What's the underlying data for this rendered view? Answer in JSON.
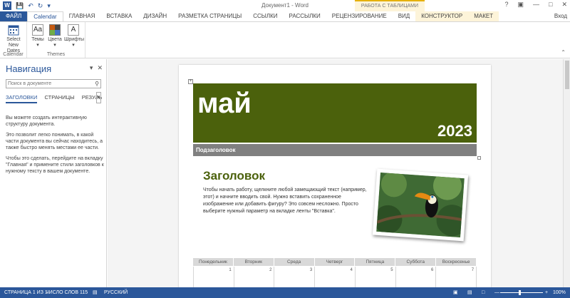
{
  "titlebar": {
    "title": "Документ1 - Word",
    "context_banner": "РАБОТА С ТАБЛИЦАМИ",
    "signin": "Вход",
    "word_icon": "W",
    "qat": {
      "save_icon": "save-icon",
      "undo_icon": "undo-icon",
      "redo_icon": "redo-icon",
      "customize_icon": "customize-qat-icon"
    },
    "window_controls": {
      "help": "?",
      "ribbon_options": "▣",
      "minimize": "—",
      "maximize": "□",
      "close": "✕"
    }
  },
  "tabs": [
    {
      "label": "ФАЙЛ"
    },
    {
      "label": "Calendar"
    },
    {
      "label": "ГЛАВНАЯ"
    },
    {
      "label": "ВСТАВКА"
    },
    {
      "label": "ДИЗАЙН"
    },
    {
      "label": "РАЗМЕТКА СТРАНИЦЫ"
    },
    {
      "label": "ССЫЛКИ"
    },
    {
      "label": "РАССЫЛКИ"
    },
    {
      "label": "РЕЦЕНЗИРОВАНИЕ"
    },
    {
      "label": "ВИД"
    },
    {
      "label": "КОНСТРУКТОР"
    },
    {
      "label": "МАКЕТ"
    }
  ],
  "ribbon": {
    "calendar_group": {
      "label": "Calendar",
      "select_dates_line1": "Select",
      "select_dates_line2": "New Dates"
    },
    "themes_group": {
      "label": "Themes",
      "themes_btn": "Темы",
      "colors_btn": "Цвета",
      "fonts_btn": "Шрифты",
      "fonts_glyph": "A",
      "themes_glyph": "Aa",
      "dropdown": "▾"
    }
  },
  "navpane": {
    "title": "Навигация",
    "search_placeholder": "Поиск в документе",
    "tabs": [
      "ЗАГОЛОВКИ",
      "СТРАНИЦЫ",
      "РЕЗУЛЬ"
    ],
    "more": "▸",
    "paragraphs": [
      "Вы можете создать интерактивную структуру документа.",
      "Это позволит легко понимать, в какой части документа вы сейчас находитесь, а также быстро менять местами ее части.",
      "Чтобы это сделать, перейдите на вкладку \"Главная\" и примените стили заголовков к нужному тексту в вашем документе."
    ]
  },
  "document": {
    "month": "май",
    "year": "2023",
    "subtitle": "Подзаголовок",
    "heading": "Заголовок",
    "body": "Чтобы начать работу, щелкните любой замещающий текст (например, этот) и начните вводить свой. Нужно вставить сохраненное изображение или добавить фигуру? Это совсем несложно. Просто выберите нужный параметр на вкладке ленты \"Вставка\".",
    "photo_icon": "toucan-photo",
    "table_handle": "+",
    "weekdays": [
      "Понедельник",
      "Вторник",
      "Среда",
      "Четверг",
      "Пятница",
      "Суббота",
      "Воскресенье"
    ],
    "week1": [
      "1",
      "2",
      "3",
      "4",
      "5",
      "6",
      "7"
    ],
    "banner_color": "#4b610c"
  },
  "statusbar": {
    "page": "СТРАНИЦА 1 ИЗ 1",
    "words": "ЧИСЛО СЛОВ 115",
    "lang": "РУССКИЙ",
    "zoom": "100%",
    "zoom_minus": "—",
    "zoom_plus": "+"
  },
  "colors": {
    "accent": "#2b579a",
    "context": "#fdf4d9"
  }
}
